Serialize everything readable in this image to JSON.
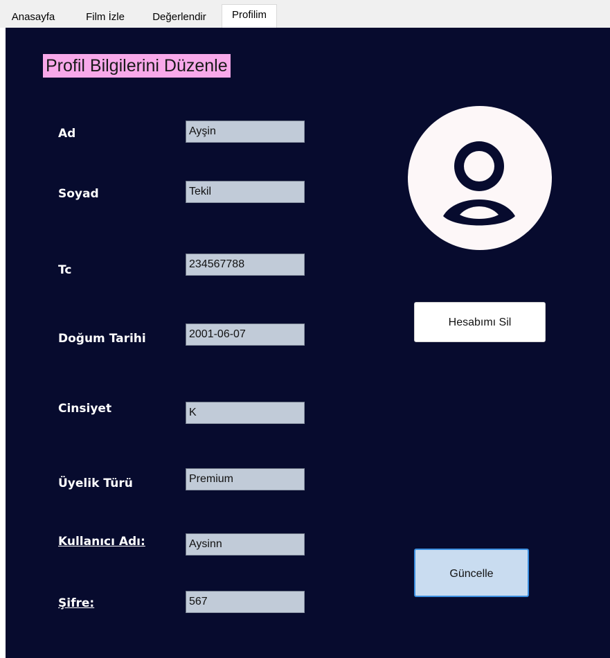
{
  "tabs": [
    {
      "label": "Anasayfa"
    },
    {
      "label": "Film İzle"
    },
    {
      "label": "Değerlendir"
    },
    {
      "label": "Profilim"
    }
  ],
  "active_tab": "Profilim",
  "page_title": "Profil Bilgilerini Düzenle",
  "fields": {
    "ad": {
      "label": "Ad",
      "value": "Ayşin"
    },
    "soyad": {
      "label": "Soyad",
      "value": "Tekil"
    },
    "tc": {
      "label": "Tc",
      "value": "234567788"
    },
    "dogum_tarihi": {
      "label": "Doğum Tarihi",
      "value": "2001-06-07"
    },
    "cinsiyet": {
      "label": "Cinsiyet",
      "value": "K"
    },
    "uyelik_turu": {
      "label": "Üyelik Türü",
      "value": "Premium"
    },
    "kullanici_adi": {
      "label": "Kullanıcı Adı:",
      "value": "Aysinn"
    },
    "sifre": {
      "label": "Şifre:",
      "value": "567"
    }
  },
  "buttons": {
    "delete_account": "Hesabımı Sil",
    "update": "Güncelle"
  },
  "avatar_icon": "user-profile-icon",
  "colors": {
    "panel_background": "#070b2e",
    "title_highlight": "#f8a9ea",
    "field_background": "#c1cbd8",
    "update_button_border": "#3b8fe0"
  }
}
